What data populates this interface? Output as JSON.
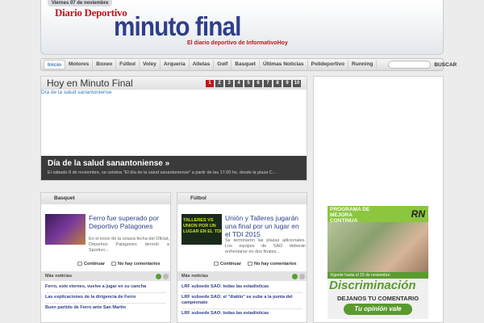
{
  "header": {
    "date": "Viernes 07 de noviembre",
    "brand_top": "Diario Deportivo",
    "brand_main": "minuto final",
    "brand_sub": "El diario deportivo de InformativoHoy"
  },
  "nav": {
    "items": [
      "Inicio",
      "Motores",
      "Boxeo",
      "Fútbol",
      "Voley",
      "Arquería",
      "Atletas",
      "Golf",
      "Basquet",
      "Últimas Noticias",
      "Polideportivo",
      "Running"
    ],
    "search_placeholder": "",
    "search_button": "BUSCAR"
  },
  "featured": {
    "title": "Hoy en Minuto Final",
    "pages": [
      "1",
      "2",
      "3",
      "4",
      "5",
      "6",
      "7",
      "8",
      "9",
      "10"
    ],
    "link": "Día de la salud sanantoniense",
    "caption_title": "Día de la salud sanantoniense »",
    "caption_text": "El sábado 8 de noviembre, se celebra \"El día de la salud sanantoniense\" a partir de las 17.00 hs. desde la plaza C..."
  },
  "basquet": {
    "heading": "Basquet",
    "story_title": "Ferro fue superado por Deportivo Patagones",
    "story_text": "En el inicio de la octava fecha del Oficial, Deportivo Patagones derrotó a Sportivo...",
    "continue": "Continuar",
    "comments": "No hay comentarios",
    "mas": "Más noticias",
    "more": [
      "Ferro, este viernes, vuelve a jugar en su cancha",
      "Las explicaciones de la dirigencia de Ferro",
      "Buen partido de Ferro ante San Martín"
    ]
  },
  "futbol": {
    "heading": "Fútbol",
    "thumb_text": "TALLERES VS UNION POR UN LUGAR EN EL TDI",
    "story_title": "Unión y Talleres jugarán una final por un lugar en el TDI 2015",
    "story_text": "Se terminaron las plazas adicionales. Los equipos de SAO deberán enfrentarse en dos finales...",
    "continue": "Continuar",
    "comments": "No hay comentarios",
    "mas": "Más noticias",
    "more": [
      "LRF subsede SAO: todas las estadísticas",
      "LRF subsede SAO: el \"diablo\" se sube a la punta del campeonato",
      "LRF subsede SAO: todas las estadísticas"
    ]
  },
  "ad": {
    "line1": "PROGRAMA DE",
    "line2": "MEJORA",
    "line3": "CONTINUA",
    "logo": "RN",
    "vigente": "Vigente hasta el 15 de noviembre",
    "big": "Discriminación",
    "comment": "DEJANOS TU COMENTARIO",
    "button": "Tu opinión vale"
  }
}
